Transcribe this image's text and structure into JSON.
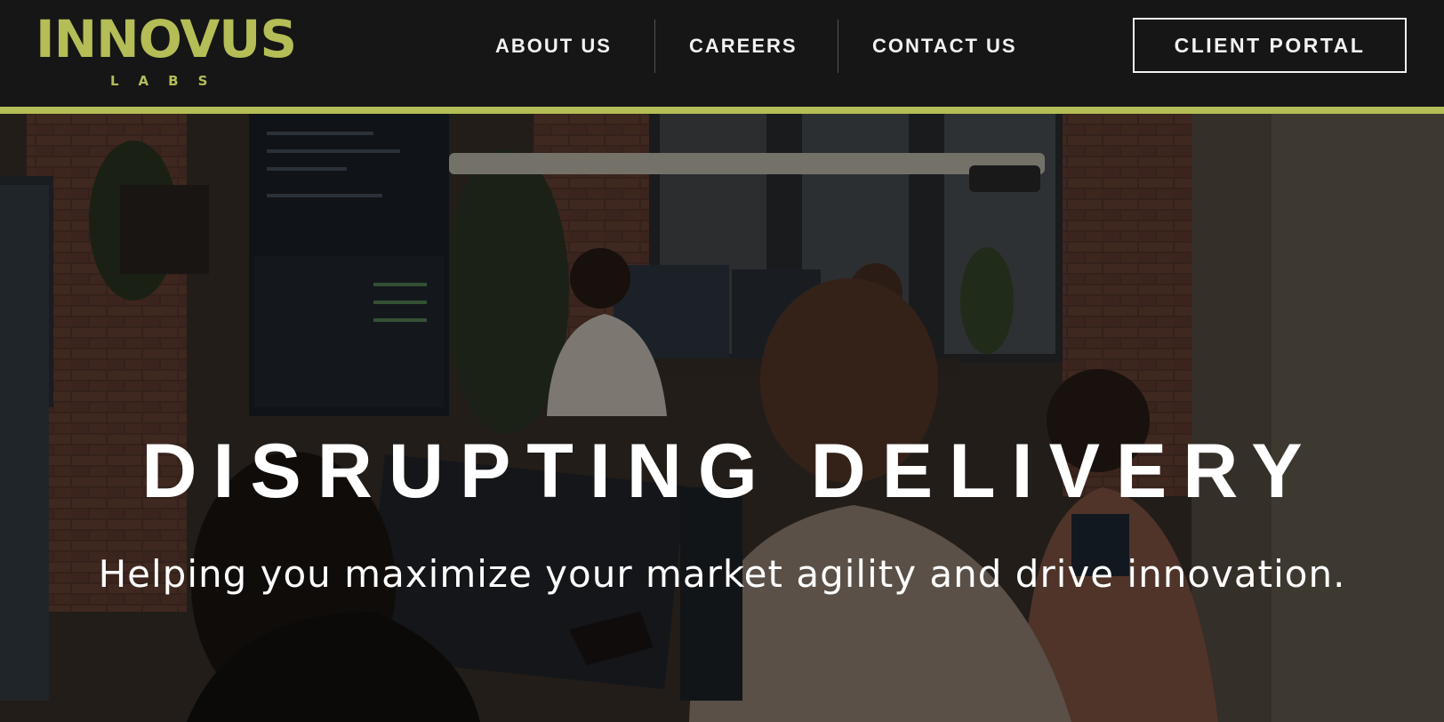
{
  "brand": {
    "name": "INNOVUS",
    "tagline": "LABS",
    "accent_color": "#b4bd56"
  },
  "nav": {
    "items": [
      {
        "label": "ABOUT US"
      },
      {
        "label": "CAREERS"
      },
      {
        "label": "CONTACT US"
      }
    ],
    "cta_label": "CLIENT PORTAL"
  },
  "hero": {
    "title": "DISRUPTING DELIVERY",
    "subtitle": "Helping you maximize your market agility and drive innovation."
  }
}
